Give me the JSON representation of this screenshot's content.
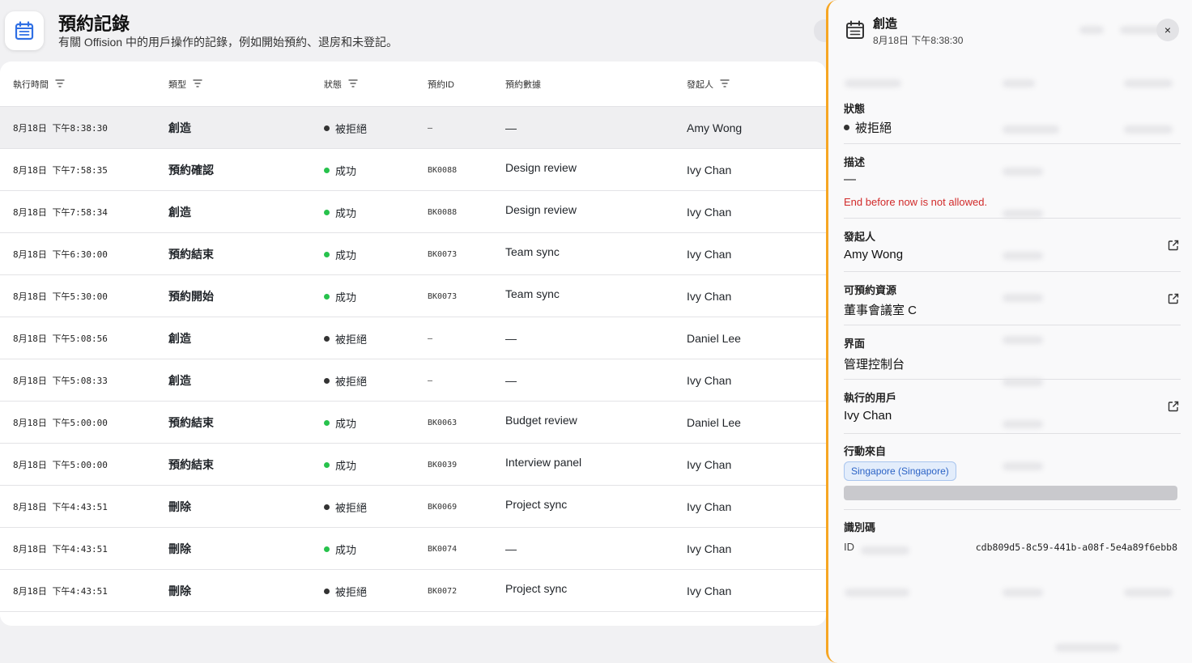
{
  "header": {
    "title": "預約記錄",
    "subtitle": "有關 Offision 中的用戶操作的記錄，例如開始預約、退房和未登記。"
  },
  "table": {
    "columns": {
      "time": "執行時間",
      "type": "類型",
      "status": "狀態",
      "booking_id": "預約ID",
      "booking_data": "預約數據",
      "initiator": "發起人"
    },
    "rows": [
      {
        "time": "8月18日 下午8:38:30",
        "type": "創造",
        "status": "被拒絕",
        "status_color": "#333333",
        "booking_id": "–",
        "data": "—",
        "user": "Amy Wong"
      },
      {
        "time": "8月18日 下午7:58:35",
        "type": "預約確認",
        "status": "成功",
        "status_color": "#27c24c",
        "booking_id": "BK0088",
        "data": "Design review",
        "user": "Ivy Chan"
      },
      {
        "time": "8月18日 下午7:58:34",
        "type": "創造",
        "status": "成功",
        "status_color": "#27c24c",
        "booking_id": "BK0088",
        "data": "Design review",
        "user": "Ivy Chan"
      },
      {
        "time": "8月18日 下午6:30:00",
        "type": "預約結束",
        "status": "成功",
        "status_color": "#27c24c",
        "booking_id": "BK0073",
        "data": "Team sync",
        "user": "Ivy Chan"
      },
      {
        "time": "8月18日 下午5:30:00",
        "type": "預約開始",
        "status": "成功",
        "status_color": "#27c24c",
        "booking_id": "BK0073",
        "data": "Team sync",
        "user": "Ivy Chan"
      },
      {
        "time": "8月18日 下午5:08:56",
        "type": "創造",
        "status": "被拒絕",
        "status_color": "#333333",
        "booking_id": "–",
        "data": "—",
        "user": "Daniel Lee"
      },
      {
        "time": "8月18日 下午5:08:33",
        "type": "創造",
        "status": "被拒絕",
        "status_color": "#333333",
        "booking_id": "–",
        "data": "—",
        "user": "Ivy Chan"
      },
      {
        "time": "8月18日 下午5:00:00",
        "type": "預約結束",
        "status": "成功",
        "status_color": "#27c24c",
        "booking_id": "BK0063",
        "data": "Budget review",
        "user": "Daniel Lee"
      },
      {
        "time": "8月18日 下午5:00:00",
        "type": "預約結束",
        "status": "成功",
        "status_color": "#27c24c",
        "booking_id": "BK0039",
        "data": "Interview panel",
        "user": "Ivy Chan"
      },
      {
        "time": "8月18日 下午4:43:51",
        "type": "刪除",
        "status": "被拒絕",
        "status_color": "#333333",
        "booking_id": "BK0069",
        "data": "Project sync",
        "user": "Ivy Chan"
      },
      {
        "time": "8月18日 下午4:43:51",
        "type": "刪除",
        "status": "成功",
        "status_color": "#27c24c",
        "booking_id": "BK0074",
        "data": "—",
        "user": "Ivy Chan"
      },
      {
        "time": "8月18日 下午4:43:51",
        "type": "刪除",
        "status": "被拒絕",
        "status_color": "#333333",
        "booking_id": "BK0072",
        "data": "Project sync",
        "user": "Ivy Chan"
      }
    ]
  },
  "panel": {
    "title": "創造",
    "timestamp": "8月18日 下午8:38:30",
    "close_label": "×",
    "status_label": "狀態",
    "status_value": "被拒絕",
    "description_label": "描述",
    "description_value": "—",
    "error": "End before now is not allowed.",
    "initiator_label": "發起人",
    "initiator_value": "Amy Wong",
    "resource_label": "可預約資源",
    "resource_value": "董事會議室 C",
    "interface_label": "界面",
    "interface_value": "管理控制台",
    "actor_label": "執行的用戶",
    "actor_value": "Ivy Chan",
    "origin_label": "行動來自",
    "origin_badge": "Singapore (Singapore)",
    "identifier_label": "識別碼",
    "id_label": "ID",
    "id_value": "cdb809d5-8c59-441b-a08f-5e4a89f6ebb8"
  },
  "colors": {
    "accent": "#f6a623",
    "success": "#27c24c",
    "rejected": "#333333",
    "error": "#d12a2a",
    "icon_blue": "#2f6fe4"
  },
  "icons": {
    "app": "calendar-list-icon",
    "filter": "filter-icon",
    "external_link": "external-link-icon",
    "close": "close-icon"
  }
}
